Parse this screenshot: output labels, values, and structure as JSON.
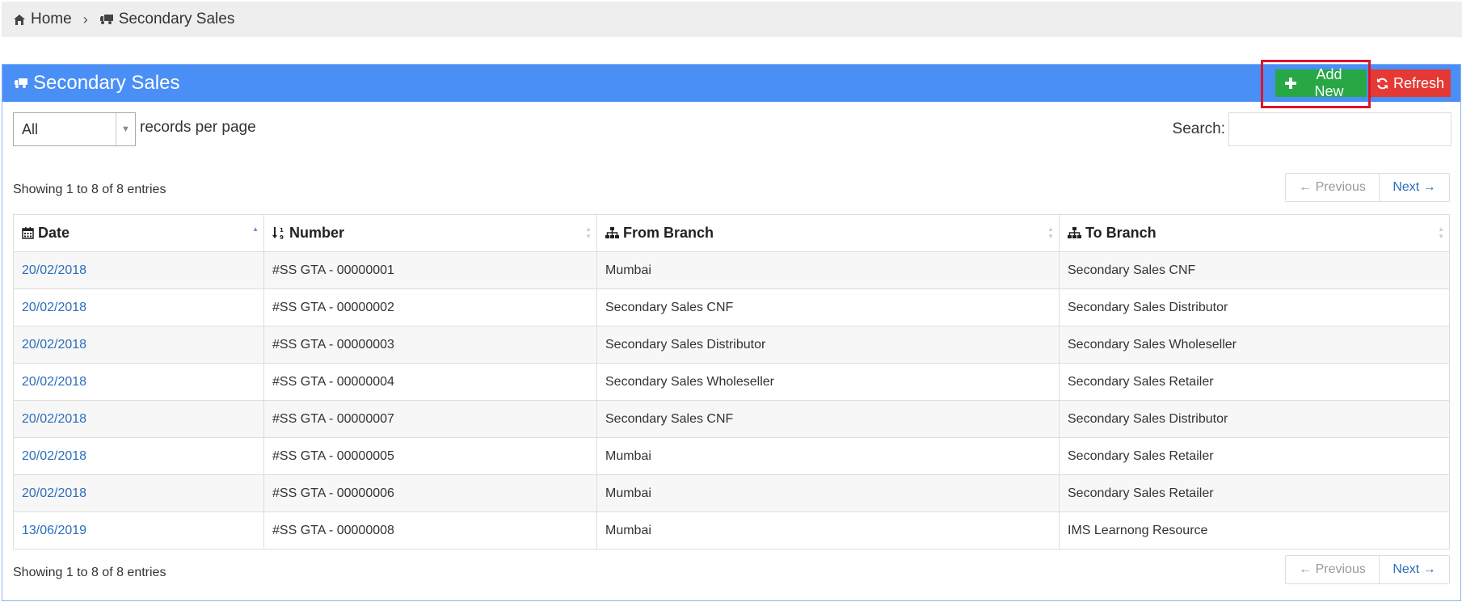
{
  "breadcrumb": {
    "home_label": "Home",
    "separator": "›",
    "current_label": "Secondary Sales"
  },
  "panel": {
    "title": "Secondary Sales",
    "add_new_label": "Add New",
    "refresh_label": "Refresh"
  },
  "controls": {
    "page_size_value": "All",
    "per_page_label": "records per page",
    "search_label": "Search:",
    "search_value": ""
  },
  "info_text": "Showing 1 to 8 of 8 entries",
  "pagination": {
    "prev_label": "← Previous",
    "next_label": "Next →"
  },
  "table": {
    "headers": {
      "date": "Date",
      "number": "Number",
      "from_branch": "From Branch",
      "to_branch": "To Branch"
    },
    "rows": [
      {
        "date": "20/02/2018",
        "number": "#SS GTA - 00000001",
        "from": "Mumbai",
        "to": "Secondary Sales CNF"
      },
      {
        "date": "20/02/2018",
        "number": "#SS GTA - 00000002",
        "from": "Secondary Sales CNF",
        "to": "Secondary Sales Distributor"
      },
      {
        "date": "20/02/2018",
        "number": "#SS GTA - 00000003",
        "from": "Secondary Sales Distributor",
        "to": "Secondary Sales Wholeseller"
      },
      {
        "date": "20/02/2018",
        "number": "#SS GTA - 00000004",
        "from": "Secondary Sales Wholeseller",
        "to": "Secondary Sales Retailer"
      },
      {
        "date": "20/02/2018",
        "number": "#SS GTA - 00000007",
        "from": "Secondary Sales CNF",
        "to": "Secondary Sales Distributor"
      },
      {
        "date": "20/02/2018",
        "number": "#SS GTA - 00000005",
        "from": "Mumbai",
        "to": "Secondary Sales Retailer"
      },
      {
        "date": "20/02/2018",
        "number": "#SS GTA - 00000006",
        "from": "Mumbai",
        "to": "Secondary Sales Retailer"
      },
      {
        "date": "13/06/2019",
        "number": "#SS GTA - 00000008",
        "from": "Mumbai",
        "to": "IMS Learnong Resource"
      }
    ]
  },
  "colors": {
    "header_blue": "#4a8ff5",
    "add_green": "#28a745",
    "refresh_red": "#e53935",
    "highlight_red": "#e0132b",
    "link_blue": "#2a6ebb"
  },
  "icons": {
    "home": "home-icon",
    "truck": "truck-icon",
    "plus": "plus-icon",
    "refresh": "refresh-icon",
    "calendar": "calendar-icon",
    "numeric_sort": "numeric-sort-icon",
    "sitemap": "sitemap-icon"
  }
}
